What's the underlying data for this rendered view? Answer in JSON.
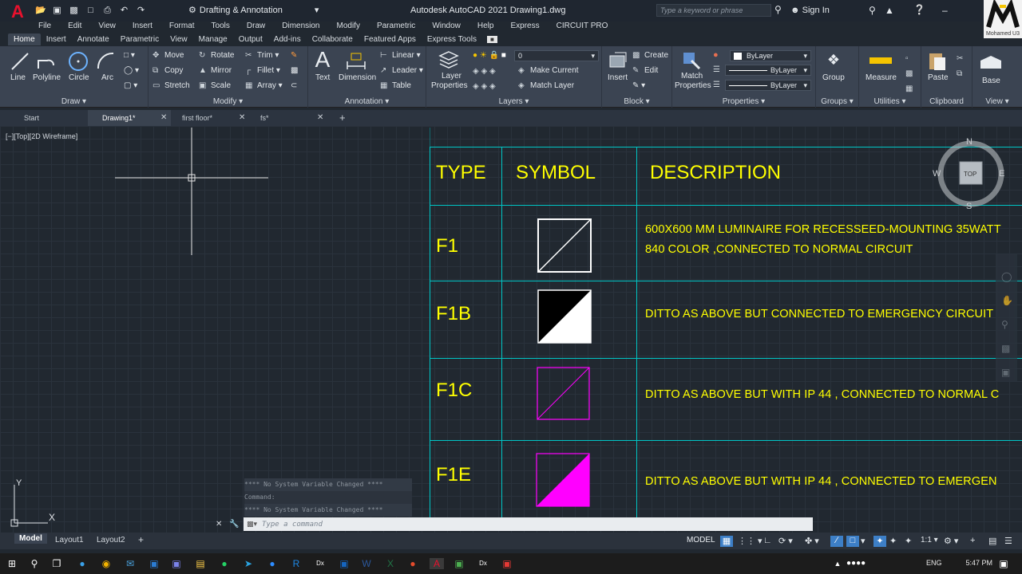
{
  "app": {
    "logo": "A",
    "title": "Autodesk AutoCAD 2021  Drawing1.dwg",
    "workspace": "Drafting & Annotation",
    "search_placeholder": "Type a keyword or phrase",
    "sign_in": "Sign In",
    "corner_label": "Mohamed U3"
  },
  "menu": [
    "File",
    "Edit",
    "View",
    "Insert",
    "Format",
    "Tools",
    "Draw",
    "Dimension",
    "Modify",
    "Parametric",
    "Window",
    "Help",
    "Express",
    "CIRCUIT PRO"
  ],
  "ribbon_tabs": [
    "Home",
    "Insert",
    "Annotate",
    "Parametric",
    "View",
    "Manage",
    "Output",
    "Add-ins",
    "Collaborate",
    "Featured Apps",
    "Express Tools"
  ],
  "ribbon": {
    "draw": {
      "title": "Draw",
      "line": "Line",
      "polyline": "Polyline",
      "circle": "Circle",
      "arc": "Arc"
    },
    "modify": {
      "title": "Modify",
      "move": "Move",
      "rotate": "Rotate",
      "trim": "Trim",
      "copy": "Copy",
      "mirror": "Mirror",
      "fillet": "Fillet",
      "stretch": "Stretch",
      "scale": "Scale",
      "array": "Array"
    },
    "annotation": {
      "title": "Annotation",
      "text": "Text",
      "dimension": "Dimension",
      "linear": "Linear",
      "leader": "Leader",
      "table": "Table"
    },
    "layers": {
      "title": "Layers",
      "layer_properties_1": "Layer",
      "layer_properties_2": "Properties",
      "current_layer": "0",
      "make_current": "Make Current",
      "match_layer": "Match Layer"
    },
    "block": {
      "title": "Block",
      "insert": "Insert",
      "create": "Create",
      "edit": "Edit"
    },
    "properties": {
      "title": "Properties",
      "match_1": "Match",
      "match_2": "Properties",
      "color": "ByLayer",
      "linetype": "ByLayer",
      "lineweight": "ByLayer"
    },
    "groups": {
      "title": "Groups",
      "group": "Group"
    },
    "utilities": {
      "title": "Utilities",
      "measure": "Measure"
    },
    "clipboard": {
      "title": "Clipboard",
      "paste": "Paste"
    },
    "view": {
      "title": "View",
      "base": "Base"
    }
  },
  "file_tabs": {
    "start": "Start",
    "tabs": [
      "Drawing1*",
      "first floor*",
      "fs*"
    ]
  },
  "viewport": {
    "label": "[−][Top][2D Wireframe]",
    "compass": {
      "n": "N",
      "s": "S",
      "e": "E",
      "w": "W",
      "top": "TOP"
    }
  },
  "legend_table": {
    "headers": {
      "type": "TYPE",
      "symbol": "SYMBOL",
      "description": "DESCRIPTION"
    },
    "rows": [
      {
        "type": "F1",
        "desc1": "600X600 MM LUMINAIRE FOR RECESSEED-MOUNTING 35WATT",
        "desc2": "840 COLOR ,CONNECTED TO NORMAL CIRCUIT"
      },
      {
        "type": "F1B",
        "desc1": "DITTO AS ABOVE BUT CONNECTED TO EMERGENCY CIRCUIT"
      },
      {
        "type": "F1C",
        "desc1": "DITTO AS ABOVE BUT WITH IP 44 , CONNECTED TO NORMAL C"
      },
      {
        "type": "F1E",
        "desc1": "DITTO AS ABOVE BUT WITH IP 44 , CONNECTED TO EMERGEN"
      }
    ],
    "colors": {
      "text": "#ffff00",
      "grid": "#00c6c6",
      "white": "#ffffff",
      "magenta": "#ff00ff"
    }
  },
  "ucs": {
    "x": "X",
    "y": "Y"
  },
  "command": {
    "history": [
      "**** No System Variable Changed ****",
      "Command:",
      "**** No System Variable Changed ****"
    ],
    "placeholder": "Type a command"
  },
  "layout_tabs": [
    "Model",
    "Layout1",
    "Layout2"
  ],
  "status": {
    "model": "MODEL",
    "scale": "1:1"
  },
  "tray": {
    "lang": "ENG",
    "time": "5:47 PM"
  }
}
